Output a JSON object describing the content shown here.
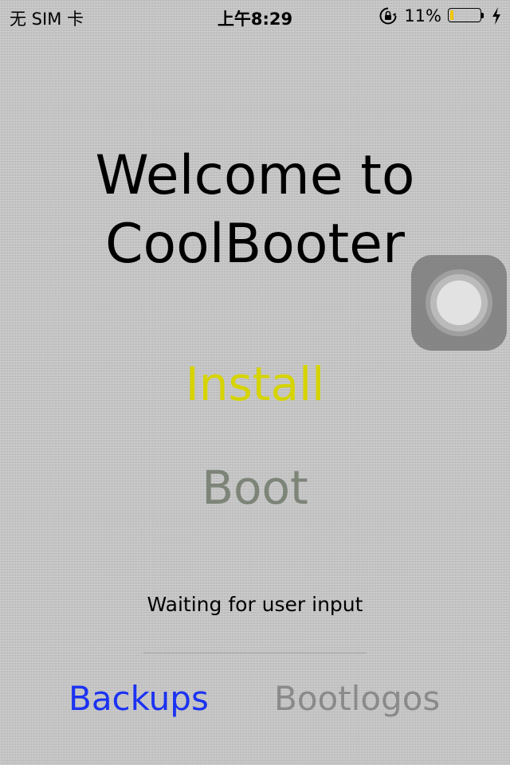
{
  "status_bar": {
    "carrier": "无 SIM 卡",
    "time": "上午8:29",
    "battery_percent": "11%",
    "battery_level": 0.11,
    "icons": [
      "orientation-lock-icon",
      "battery-icon",
      "charging-bolt-icon"
    ]
  },
  "main": {
    "welcome_line1": "Welcome to",
    "welcome_line2": "CoolBooter",
    "install_label": "Install",
    "boot_label": "Boot",
    "status_text": "Waiting for user input",
    "progress": 0
  },
  "bottom": {
    "backups_label": "Backups",
    "bootlogos_label": "Bootlogos"
  },
  "colors": {
    "install": "#d6d400",
    "boot": "#7d8478",
    "backups": "#1b32f2",
    "bootlogos": "#8a8a8a",
    "battery_fill": "#f2c600",
    "progress": "#007aff"
  }
}
